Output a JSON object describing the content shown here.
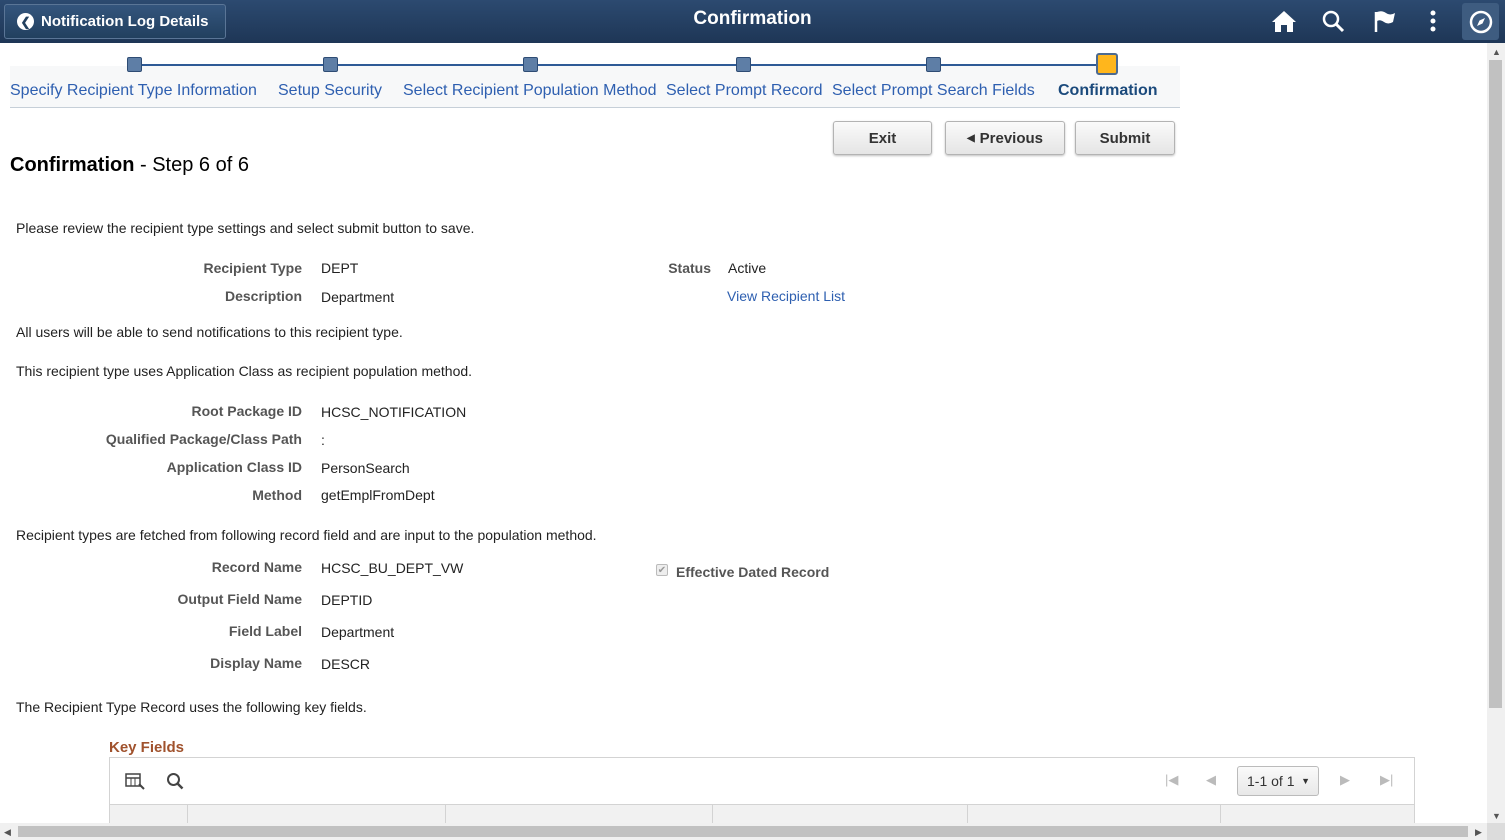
{
  "header": {
    "back_label": "Notification Log Details",
    "title": "Confirmation",
    "icons": [
      "home-icon",
      "search-icon",
      "flag-icon",
      "more-icon",
      "navigator-icon"
    ],
    "bg_color": "#1e3656"
  },
  "train": {
    "steps": [
      {
        "label": "Specify Recipient Type Information"
      },
      {
        "label": "Setup Security"
      },
      {
        "label": "Select Recipient Population Method"
      },
      {
        "label": "Select Prompt Record"
      },
      {
        "label": "Select Prompt Search Fields"
      },
      {
        "label": "Confirmation"
      }
    ],
    "current_step": 6,
    "current_color": "#ffb61c"
  },
  "buttons": {
    "exit": "Exit",
    "previous": "Previous",
    "submit": "Submit"
  },
  "page": {
    "title": "Confirmation",
    "subtitle": " - Step 6 of 6",
    "intro": "Please review the recipient type settings and select submit button to save."
  },
  "summary": {
    "recipient_type_label": "Recipient Type",
    "recipient_type": "DEPT",
    "description_label": "Description",
    "description": "Department",
    "status_label": "Status",
    "status": "Active",
    "view_list_link": "View Recipient List",
    "all_users_text": "All users will be able to send notifications to this recipient type.",
    "population_text": "This recipient type uses Application Class as recipient population method."
  },
  "app_class": {
    "root_package_label": "Root Package ID",
    "root_package": "HCSC_NOTIFICATION",
    "qualified_path_label": "Qualified Package/Class Path",
    "qualified_path": ":",
    "class_id_label": "Application Class ID",
    "class_id": "PersonSearch",
    "method_label": "Method",
    "method": "getEmplFromDept"
  },
  "record": {
    "intro": "Recipient types are fetched from following record field and are input to the population method.",
    "record_name_label": "Record Name",
    "record_name": "HCSC_BU_DEPT_VW",
    "effective_dated_label": "Effective Dated Record",
    "effective_dated_checked": true,
    "output_field_label": "Output Field Name",
    "output_field": "DEPTID",
    "field_label_label": "Field Label",
    "field_label": "Department",
    "display_name_label": "Display Name",
    "display_name": "DESCR",
    "key_fields_text": "The Recipient Type Record uses the following key fields."
  },
  "key_fields": {
    "title": "Key Fields",
    "pager": "1-1 of 1",
    "title_color": "#a0522d"
  }
}
